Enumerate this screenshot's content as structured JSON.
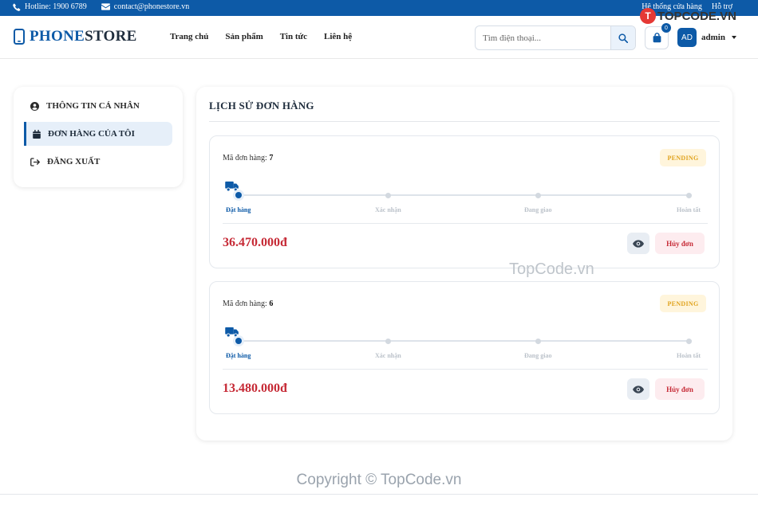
{
  "topbar": {
    "hotline": "Hotline: 1900 6789",
    "email": "contact@phonestore.vn",
    "store_system": "Hệ thống cửa hàng",
    "support": "Hỗ trợ"
  },
  "header": {
    "logo_phone": "PHONE",
    "logo_store": "STORE",
    "nav": [
      "Trang chủ",
      "Sản phẩm",
      "Tin tức",
      "Liên hệ"
    ],
    "search_placeholder": "Tìm điện thoại...",
    "cart_count": "0",
    "avatar_initials": "AD",
    "username": "admin"
  },
  "sidebar": {
    "items": [
      {
        "label": "THÔNG TIN CÁ NHÂN",
        "icon": "user-circle-icon"
      },
      {
        "label": "ĐƠN HÀNG CỦA TÔI",
        "icon": "calendar-icon",
        "active": true
      },
      {
        "label": "ĐĂNG XUẤT",
        "icon": "logout-icon"
      }
    ]
  },
  "main": {
    "title": "LỊCH SỬ ĐƠN HÀNG",
    "orders": [
      {
        "code_label": "Mã đơn hàng:",
        "code": "7",
        "status": "PENDING",
        "price": "36.470.000đ",
        "cancel_label": "Hủy đơn"
      },
      {
        "code_label": "Mã đơn hàng:",
        "code": "6",
        "status": "PENDING",
        "price": "13.480.000đ",
        "cancel_label": "Hủy đơn"
      }
    ],
    "steps": [
      "Đặt hàng",
      "Xác nhận",
      "Đang giao",
      "Hoàn tất"
    ]
  },
  "footer": {
    "copyright": "Copyright © TopCode.vn"
  },
  "watermarks": {
    "center": "TopCode.vn",
    "corner": "TOPCODE.VN"
  },
  "colors": {
    "primary": "#0d5aa7",
    "price": "#c62a36",
    "pending": "#e0a31e"
  }
}
